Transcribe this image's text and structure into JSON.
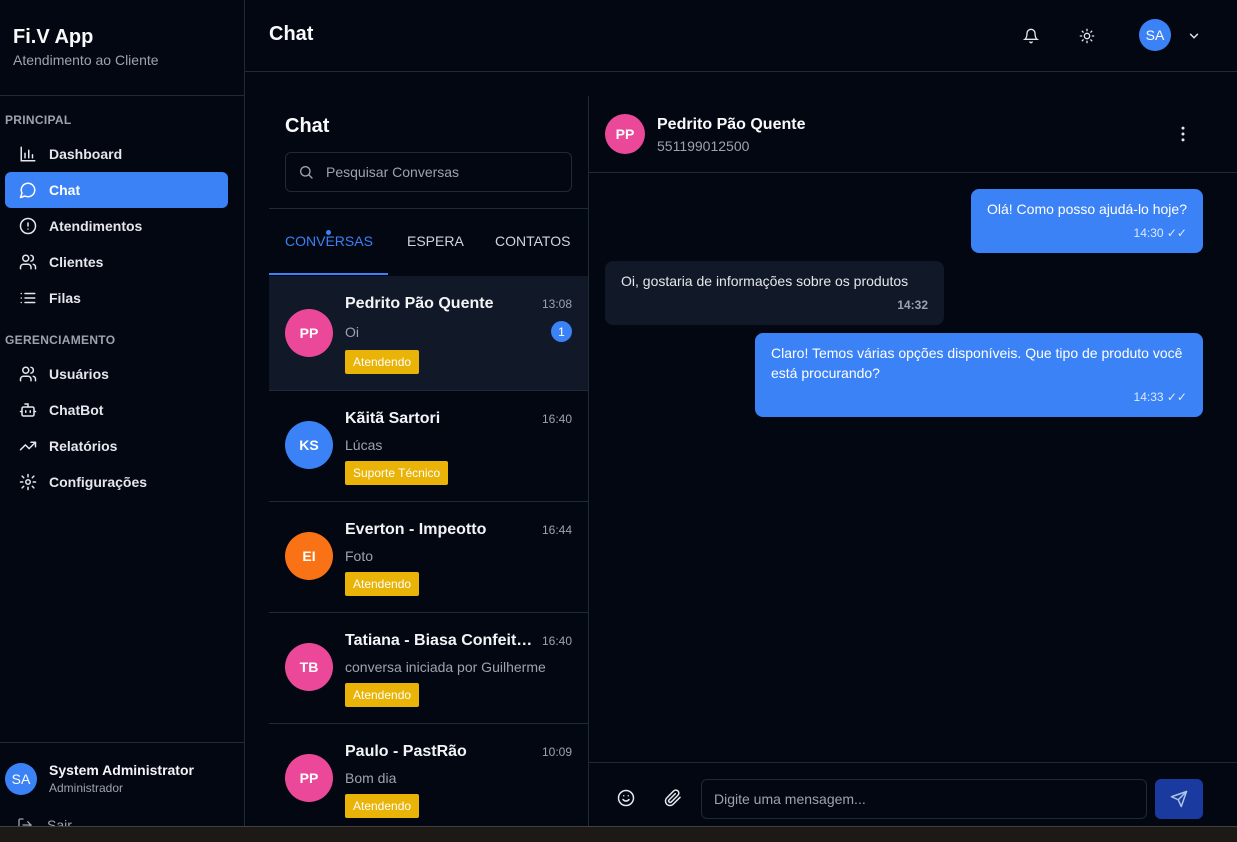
{
  "app": {
    "title": "Fi.V App",
    "subtitle": "Atendimento ao Cliente"
  },
  "sidebar": {
    "section_principal": "PRINCIPAL",
    "section_gerenciamento": "GERENCIAMENTO",
    "principal_items": [
      {
        "label": "Dashboard",
        "icon": "bar-chart-icon"
      },
      {
        "label": "Chat",
        "icon": "message-circle-icon",
        "active": true
      },
      {
        "label": "Atendimentos",
        "icon": "alert-circle-icon"
      },
      {
        "label": "Clientes",
        "icon": "users-icon"
      },
      {
        "label": "Filas",
        "icon": "list-icon"
      }
    ],
    "gerenciamento_items": [
      {
        "label": "Usuários",
        "icon": "users-icon"
      },
      {
        "label": "ChatBot",
        "icon": "bot-icon"
      },
      {
        "label": "Relatórios",
        "icon": "trending-up-icon"
      },
      {
        "label": "Configurações",
        "icon": "gear-icon"
      }
    ],
    "user": {
      "initials": "SA",
      "name": "System Administrator",
      "role": "Administrador"
    },
    "logout_label": "Sair"
  },
  "header": {
    "title": "Chat",
    "avatar_initials": "SA"
  },
  "conversations_panel": {
    "title": "Chat",
    "search_placeholder": "Pesquisar Conversas",
    "tabs": [
      "CONVERSAS",
      "ESPERA",
      "CONTATOS"
    ],
    "items": [
      {
        "initials": "PP",
        "name": "Pedrito Pão Quente",
        "time": "13:08",
        "message": "Oi",
        "tag": "Atendendo",
        "unread": "1",
        "avatar_color": "#ec4899"
      },
      {
        "initials": "KS",
        "name": "Kãitã Sartori",
        "time": "16:40",
        "message": "Lúcas",
        "tag": "Suporte Técnico",
        "avatar_color": "#3b82f6"
      },
      {
        "initials": "EI",
        "name": "Everton - Impeotto",
        "time": "16:44",
        "message": "Foto",
        "tag": "Atendendo",
        "avatar_color": "#f97316"
      },
      {
        "initials": "TB",
        "name": "Tatiana - Biasa Confeitaria",
        "time": "16:40",
        "message": "conversa iniciada por Guilherme",
        "tag": "Atendendo",
        "avatar_color": "#ec4899"
      },
      {
        "initials": "PP",
        "name": "Paulo - PastRão",
        "time": "10:09",
        "message": "Bom dia",
        "tag": "Atendendo",
        "avatar_color": "#ec4899"
      }
    ]
  },
  "chat": {
    "contact_initials": "PP",
    "contact_name": "Pedrito Pão Quente",
    "contact_phone": "551199012500",
    "messages": [
      {
        "direction": "out",
        "text": "Olá! Como posso ajudá-lo hoje?",
        "time": "14:30 ✓✓"
      },
      {
        "direction": "in",
        "text": "Oi, gostaria de informações sobre os produtos",
        "time": "14:32"
      },
      {
        "direction": "out",
        "text": "Claro! Temos várias opções disponíveis. Que tipo de produto você está procurando?",
        "time": "14:33 ✓✓"
      }
    ],
    "input_placeholder": "Digite uma mensagem..."
  },
  "colors": {
    "accent": "#3b82f6",
    "tag": "#eab308",
    "background": "#030712"
  }
}
